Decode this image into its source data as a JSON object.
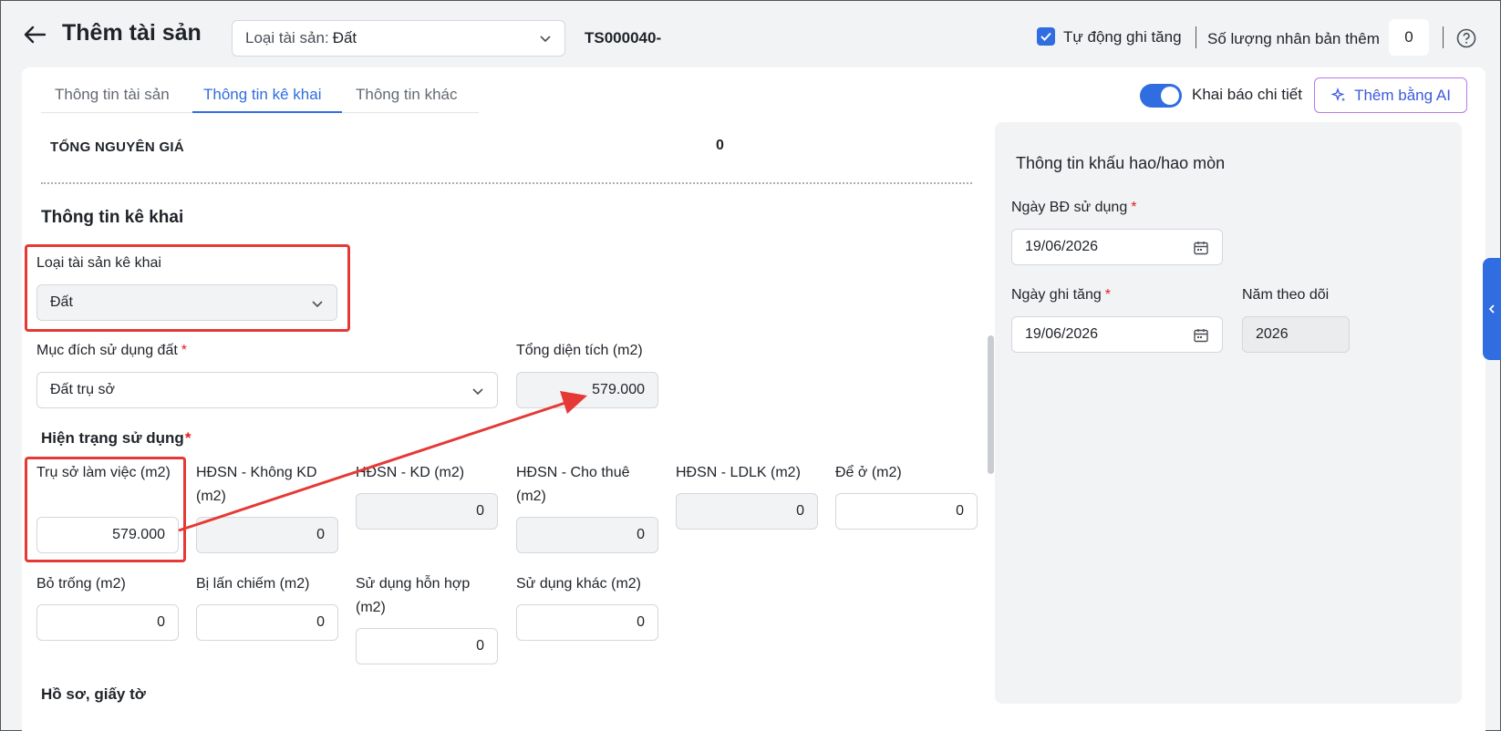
{
  "header": {
    "title": "Thêm tài sản",
    "type_label": "Loại tài sản:",
    "type_value": "Đất",
    "asset_code": "TS000040-",
    "auto_increase_label": "Tự động ghi tăng",
    "auto_increase_checked": true,
    "clone_label": "Số lượng nhân bản thêm",
    "clone_value": "0"
  },
  "tabs": [
    {
      "label": "Thông tin tài sản",
      "active": false
    },
    {
      "label": "Thông tin kê khai",
      "active": true
    },
    {
      "label": "Thông tin khác",
      "active": false
    }
  ],
  "toolbar": {
    "detail_toggle_label": "Khai báo chi tiết",
    "detail_toggle_on": true,
    "ai_button_label": "Thêm bằng AI"
  },
  "total": {
    "label": "TỔNG NGUYÊN GIÁ",
    "value": "0"
  },
  "declaration": {
    "title": "Thông tin kê khai",
    "asset_type_label": "Loại tài sản kê khai",
    "asset_type_value": "Đất",
    "purpose_label": "Mục đích sử dụng đất",
    "purpose_value": "Đất trụ sở",
    "total_area_label": "Tổng diện tích (m2)",
    "total_area_value": "579.000",
    "status_title": "Hiện trạng sử dụng",
    "status_fields": [
      {
        "label": "Trụ sở làm việc (m2)",
        "value": "579.000"
      },
      {
        "label": "HĐSN - Không KD (m2)",
        "value": "0"
      },
      {
        "label": "HĐSN - KD (m2)",
        "value": "0"
      },
      {
        "label": "HĐSN - Cho thuê (m2)",
        "value": "0"
      },
      {
        "label": "HĐSN - LDLK (m2)",
        "value": "0"
      },
      {
        "label": "Để ở (m2)",
        "value": "0"
      },
      {
        "label": "Bỏ trống (m2)",
        "value": "0"
      },
      {
        "label": "Bị lấn chiếm (m2)",
        "value": "0"
      },
      {
        "label": "Sử dụng hỗn hợp (m2)",
        "value": "0"
      },
      {
        "label": "Sử dụng khác (m2)",
        "value": "0"
      }
    ],
    "documents_title": "Hồ sơ, giấy tờ"
  },
  "depreciation": {
    "title": "Thông tin khấu hao/hao mòn",
    "start_date_label": "Ngày BĐ sử dụng",
    "start_date_value": "19/06/2026",
    "increase_date_label": "Ngày ghi tăng",
    "increase_date_value": "19/06/2026",
    "tracking_year_label": "Năm theo dõi",
    "tracking_year_value": "2026"
  },
  "colors": {
    "accent": "#2f6de1",
    "highlight": "#e53935",
    "required": "#e02020"
  }
}
